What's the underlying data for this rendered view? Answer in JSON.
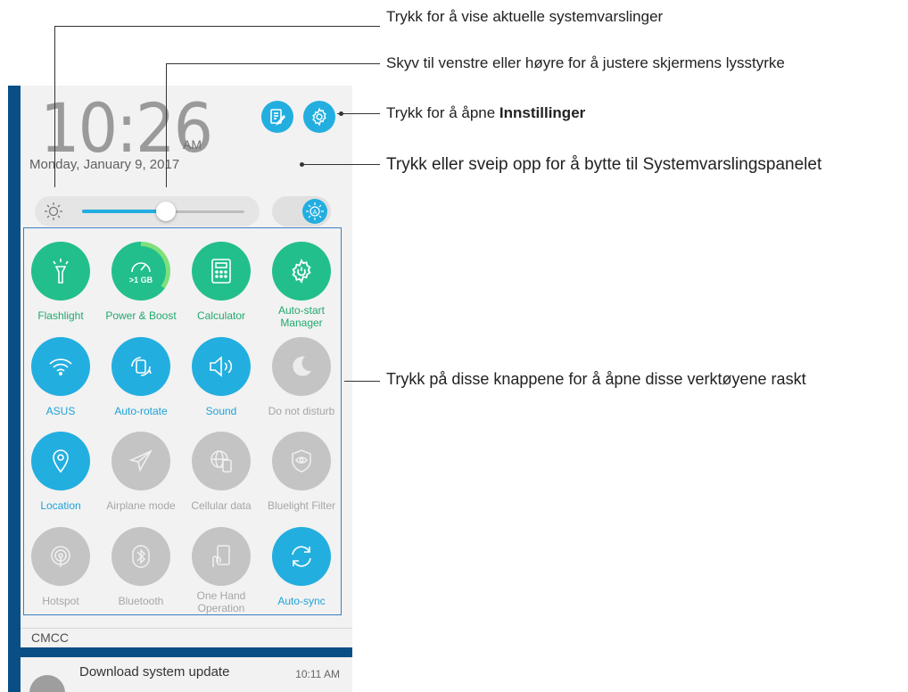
{
  "status": {
    "time_big": "10:26",
    "ampm": "AM",
    "date": "Monday, January 9, 2017"
  },
  "header_icons": {
    "edit": "edit-notes-icon",
    "settings": "settings-gear-icon"
  },
  "brightness": {
    "level_percent": 48,
    "auto_icon": "auto-brightness-icon"
  },
  "tiles": [
    {
      "label": "Flashlight",
      "icon": "flashlight-icon",
      "state": "on"
    },
    {
      "label": "Power & Boost",
      "icon": "speedometer-icon",
      "sub": ">1 GB",
      "state": "on"
    },
    {
      "label": "Calculator",
      "icon": "calculator-icon",
      "state": "on"
    },
    {
      "label": "Auto-start Manager",
      "icon": "gear-power-icon",
      "state": "on"
    },
    {
      "label": "ASUS",
      "icon": "wifi-icon",
      "state": "on"
    },
    {
      "label": "Auto-rotate",
      "icon": "rotate-icon",
      "state": "on"
    },
    {
      "label": "Sound",
      "icon": "speaker-icon",
      "state": "on"
    },
    {
      "label": "Do not disturb",
      "icon": "moon-icon",
      "state": "off"
    },
    {
      "label": "Location",
      "icon": "location-pin-icon",
      "state": "on"
    },
    {
      "label": "Airplane mode",
      "icon": "airplane-icon",
      "state": "off"
    },
    {
      "label": "Cellular data",
      "icon": "globe-phone-icon",
      "state": "off"
    },
    {
      "label": "Bluelight Filter",
      "icon": "eye-shield-icon",
      "state": "off"
    },
    {
      "label": "Hotspot",
      "icon": "hotspot-icon",
      "state": "off"
    },
    {
      "label": "Bluetooth",
      "icon": "bluetooth-icon",
      "state": "off"
    },
    {
      "label": "One Hand Operation",
      "icon": "one-hand-icon",
      "state": "off"
    },
    {
      "label": "Auto-sync",
      "icon": "sync-icon",
      "state": "on"
    }
  ],
  "carrier": "CMCC",
  "notification": {
    "title": "Download system update",
    "time": "10:11 AM"
  },
  "annotations": {
    "a1": "Trykk for å vise aktuelle systemvarslinger",
    "a2": "Skyv til venstre eller høyre for å justere skjermens lysstyrke",
    "a3_pre": "Trykk for å åpne ",
    "a3_bold": "Innstillinger",
    "a4": "Trykk eller sveip opp for å bytte til Systemvarslingspanelet",
    "a5": "Trykk på disse knappene for å åpne disse verktøyene raskt"
  },
  "colors": {
    "accent": "#23aee0",
    "on_green": "#22bf8c",
    "off_gray": "#c4c4c4",
    "on_label_green": "#22a86e",
    "on_label_blue": "#1ea2d9"
  }
}
